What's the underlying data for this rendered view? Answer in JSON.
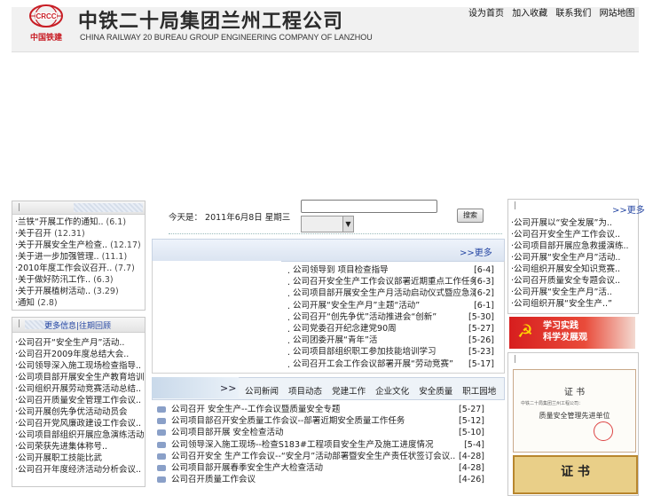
{
  "header": {
    "logo_brand": "CRCC",
    "logo_sub": "中国铁建",
    "title_cn": "中铁二十局集团兰州工程公司",
    "title_en": "CHINA RAILWAY 20 BUREAU GROUP ENGINEERING COMPANY OF LANZHOU",
    "links": [
      "设为首页",
      "加入收藏",
      "联系我们",
      "网站地图"
    ]
  },
  "left_panel_1": {
    "bar": "|",
    "items": [
      {
        "text": "·兰铁“开展工作的通知..",
        "date": "(6.1)"
      },
      {
        "text": "·关于召开",
        "date": "(12.31)"
      },
      {
        "text": "·关于开展安全生产检查..",
        "date": "(12.17)"
      },
      {
        "text": "·关于进一步加强管理..",
        "date": "(11.1)"
      },
      {
        "text": "·2010年度工作会议召开..",
        "date": "(7.7)"
      },
      {
        "text": "·关于做好防汛工作..",
        "date": "(6.3)"
      },
      {
        "text": "·关于开展植树活动..",
        "date": "(3.29)"
      },
      {
        "text": "·通知",
        "date": "(2.8)"
      }
    ]
  },
  "left_panel_2": {
    "bar": "|",
    "more": "更多信息|往期回顾",
    "items": [
      "·公司召开“安全生产月”活动..",
      "·公司召开2009年度总结大会..",
      "·公司领导深入施工现场检查指导..",
      "·公司项目部开展安全生产教育培训..",
      "·公司组织开展劳动竞赛活动总结..",
      "·公司召开质量安全管理工作会议..",
      "·公司开展创先争优活动动员会",
      "·公司召开党风廉政建设工作会议..",
      "·公司项目部组织开展应急演练活动..",
      "·公司荣获先进集体称号..",
      "·公司开展职工技能比武",
      "·公司召开年度经济活动分析会议.."
    ]
  },
  "center": {
    "date_text": "今天是： 2011年6月8日 星期三",
    "search_placeholder": "",
    "search_select": "",
    "search_button": "搜索",
    "more": ">>更多",
    "news": [
      {
        "title": "公司领导到 项目检查指导",
        "date": "[6-4]"
      },
      {
        "title": "公司召开安全生产工作会议部署近期重点工作任务..",
        "date": "[6-3]"
      },
      {
        "title": "公司项目部开展安全生产月活动启动仪式暨应急演练..",
        "date": "[6-2]"
      },
      {
        "title": "公司开展“安全生产月”主题“活动”",
        "date": "[6-1]"
      },
      {
        "title": "公司召开“创先争优”活动推进会“创新”",
        "date": "[5-30]"
      },
      {
        "title": "公司党委召开纪念建党90周",
        "date": "[5-27]"
      },
      {
        "title": "公司团委开展“青年”活",
        "date": "[5-26]"
      },
      {
        "title": "公司项目部组织职工参加技能培训学习",
        "date": "[5-23]"
      },
      {
        "title": "公司召开工会工作会议部署开展“劳动竞赛”",
        "date": "[5-17]"
      }
    ],
    "tabs_arrow": ">>",
    "tabs": [
      "公司新闻",
      "项目动态",
      "党建工作",
      "企业文化",
      "安全质量",
      "职工园地"
    ],
    "tab_news": [
      {
        "title": "公司召开   安全生产--工作会议暨质量安全专题",
        "date": "[5-27]"
      },
      {
        "title": "公司项目部召开安全质量工作会议--部署近期安全质量工作任务",
        "date": "[5-12]"
      },
      {
        "title": "公司项目部开展  安全检查活动",
        "date": "[5-10]"
      },
      {
        "title": "公司领导深入施工现场--检查S183#工程项目安全生产及施工进度情况",
        "date": "[5-4]"
      },
      {
        "title": "公司召开安全 生产工作会议--“安全月”活动部署暨安全生产责任状签订会议..",
        "date": "[4-28]"
      },
      {
        "title": "公司项目部开展春季安全生产大检查活动",
        "date": "[4-28]"
      },
      {
        "title": "公司召开质量工作会议",
        "date": "[4-26]"
      }
    ]
  },
  "right_panel_1": {
    "bar": "|",
    "more": ">>更多",
    "items": [
      "·公司开展以“安全发展”为..",
      "·公司召开安全生产工作会议..",
      "·公司项目部开展应急救援演练..",
      "·公司开展“安全生产月”活动..",
      "·公司组织开展安全知识竞赛..",
      "·公司召开质量安全专题会议..",
      "·公司开展“安全生产月”活..",
      "·公司组织开展“安全生产..”"
    ]
  },
  "banner": {
    "line1": "学习实践",
    "line2": "科学发展观"
  },
  "right_panel_2": {
    "bar": "|",
    "cert1_title": "证    书",
    "cert1_org": "中铁二十局集团兰州工程公司：",
    "cert1_award": "质量安全管理先进单位",
    "cert2_title": "证  书"
  }
}
